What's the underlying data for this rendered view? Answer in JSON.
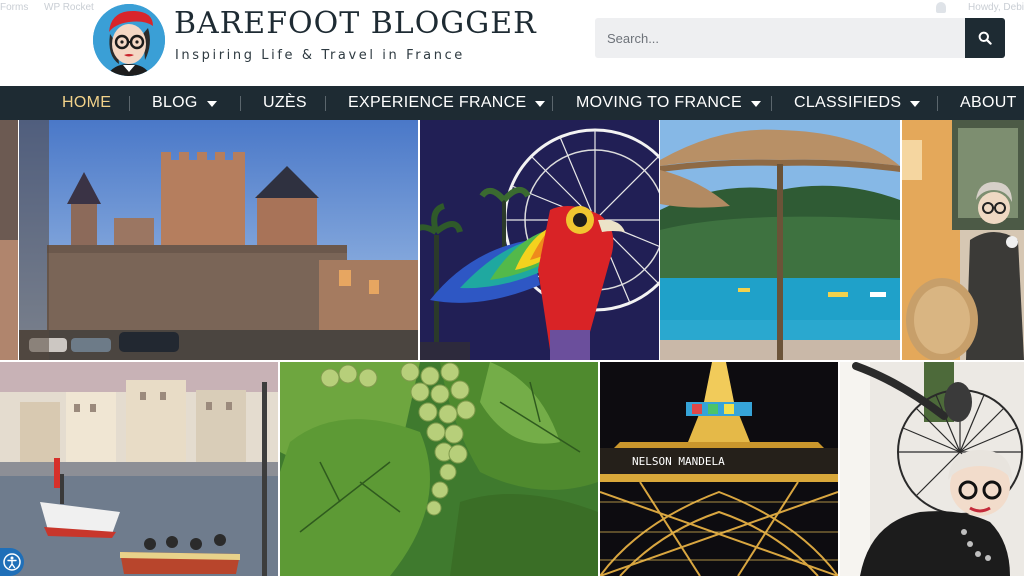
{
  "adminbar": {
    "forms_label": "Forms",
    "rocket_label": "WP Rocket",
    "howdy_label": "Howdy, Debi"
  },
  "header": {
    "site_title": "BAREFOOT BLOGGER",
    "tagline": "Inspiring Life & Travel in France",
    "logo_icon": "blogger-avatar-logo"
  },
  "search": {
    "placeholder": "Search...",
    "button_icon": "search-icon"
  },
  "nav": {
    "items": [
      {
        "label": "HOME",
        "active": true,
        "has_dropdown": false
      },
      {
        "label": "BLOG",
        "active": false,
        "has_dropdown": true
      },
      {
        "label": "UZÈS",
        "active": false,
        "has_dropdown": false
      },
      {
        "label": "EXPERIENCE FRANCE",
        "active": false,
        "has_dropdown": true
      },
      {
        "label": "MOVING TO FRANCE",
        "active": false,
        "has_dropdown": true
      },
      {
        "label": "CLASSIFIEDS",
        "active": false,
        "has_dropdown": true
      },
      {
        "label": "ABOUT",
        "active": false,
        "has_dropdown": false
      }
    ]
  },
  "gallery": {
    "tiles": [
      {
        "name": "photo-chateau-uzes"
      },
      {
        "name": "photo-parrot-ferris-wheel"
      },
      {
        "name": "photo-beach-umbrella"
      },
      {
        "name": "photo-woman-cafe"
      },
      {
        "name": "photo-sete-boats"
      },
      {
        "name": "photo-grape-vines"
      },
      {
        "name": "photo-eiffel-tower"
      },
      {
        "name": "photo-woman-sculpture"
      }
    ],
    "eiffel_sign_text": "NELSON MANDELA "
  },
  "accessibility": {
    "icon": "accessibility-icon"
  },
  "colors": {
    "nav_background": "#1e2b33",
    "nav_active": "#f2d28a",
    "search_button": "#1e2b33",
    "search_field": "#eeeff1"
  }
}
